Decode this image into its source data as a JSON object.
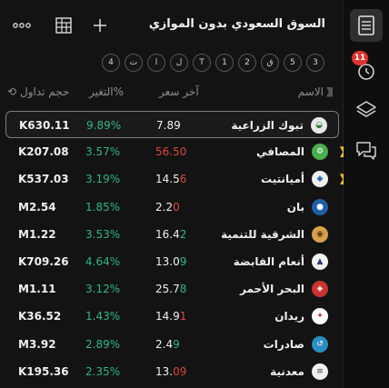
{
  "header": {
    "title": "السوق السعودي بدون الموازي",
    "more_icon": "more-horizontal-icon",
    "grid_icon": "table-grid-icon",
    "add_icon": "plus-icon"
  },
  "filters": [
    "3",
    "5",
    "ق",
    "2",
    "1",
    "T",
    "ل",
    "ا",
    "ت",
    "4"
  ],
  "columns": {
    "name": "الاسم",
    "last_price": "آخر سعر",
    "change": "التغير%",
    "volume": "حجم تداول"
  },
  "rows": [
    {
      "name": "تبوك الزراعية",
      "price_main": "7.89",
      "price_tail": "",
      "price_color": "white",
      "change": "9.89%",
      "volume": "K630.11",
      "flag": false,
      "selected": true
    },
    {
      "name": "المصافي",
      "price_main": "56.50",
      "price_tail": "",
      "price_color": "red",
      "change": "3.57%",
      "volume": "K207.08",
      "flag": true,
      "selected": false
    },
    {
      "name": "أميانتيت",
      "price_main": "14.5",
      "price_tail": "6",
      "price_color": "red",
      "change": "3.19%",
      "volume": "K537.03",
      "flag": true,
      "selected": false
    },
    {
      "name": "بان",
      "price_main": "2.2",
      "price_tail": "0",
      "price_color": "red",
      "change": "1.85%",
      "volume": "M2.54",
      "flag": false,
      "selected": false
    },
    {
      "name": "الشرقية للتنمية",
      "price_main": "16.4",
      "price_tail": "2",
      "price_color": "green",
      "change": "3.53%",
      "volume": "M1.22",
      "flag": false,
      "selected": false
    },
    {
      "name": "أنعام القابضة",
      "price_main": "13.0",
      "price_tail": "9",
      "price_color": "green",
      "change": "4.64%",
      "volume": "K709.26",
      "flag": false,
      "selected": false
    },
    {
      "name": "البحر الأحمر",
      "price_main": "25.7",
      "price_tail": "8",
      "price_color": "green",
      "change": "3.12%",
      "volume": "M1.11",
      "flag": false,
      "selected": false
    },
    {
      "name": "ريدان",
      "price_main": "14.9",
      "price_tail": "1",
      "price_color": "red",
      "change": "1.43%",
      "volume": "K36.52",
      "flag": false,
      "selected": false
    },
    {
      "name": "صادرات",
      "price_main": "2.4",
      "price_tail": "9",
      "price_color": "green",
      "change": "2.89%",
      "volume": "M3.92",
      "flag": false,
      "selected": false
    },
    {
      "name": "معدنية",
      "price_main": "13.",
      "price_tail": "09",
      "price_color": "red",
      "change": "2.35%",
      "volume": "K195.36",
      "flag": false,
      "selected": false
    }
  ],
  "rail": {
    "notifications_badge": "11"
  },
  "colors": {
    "positive": "#2fb58a",
    "negative": "#e0453a",
    "badge": "#e0322f",
    "flag": "#f4c430"
  }
}
